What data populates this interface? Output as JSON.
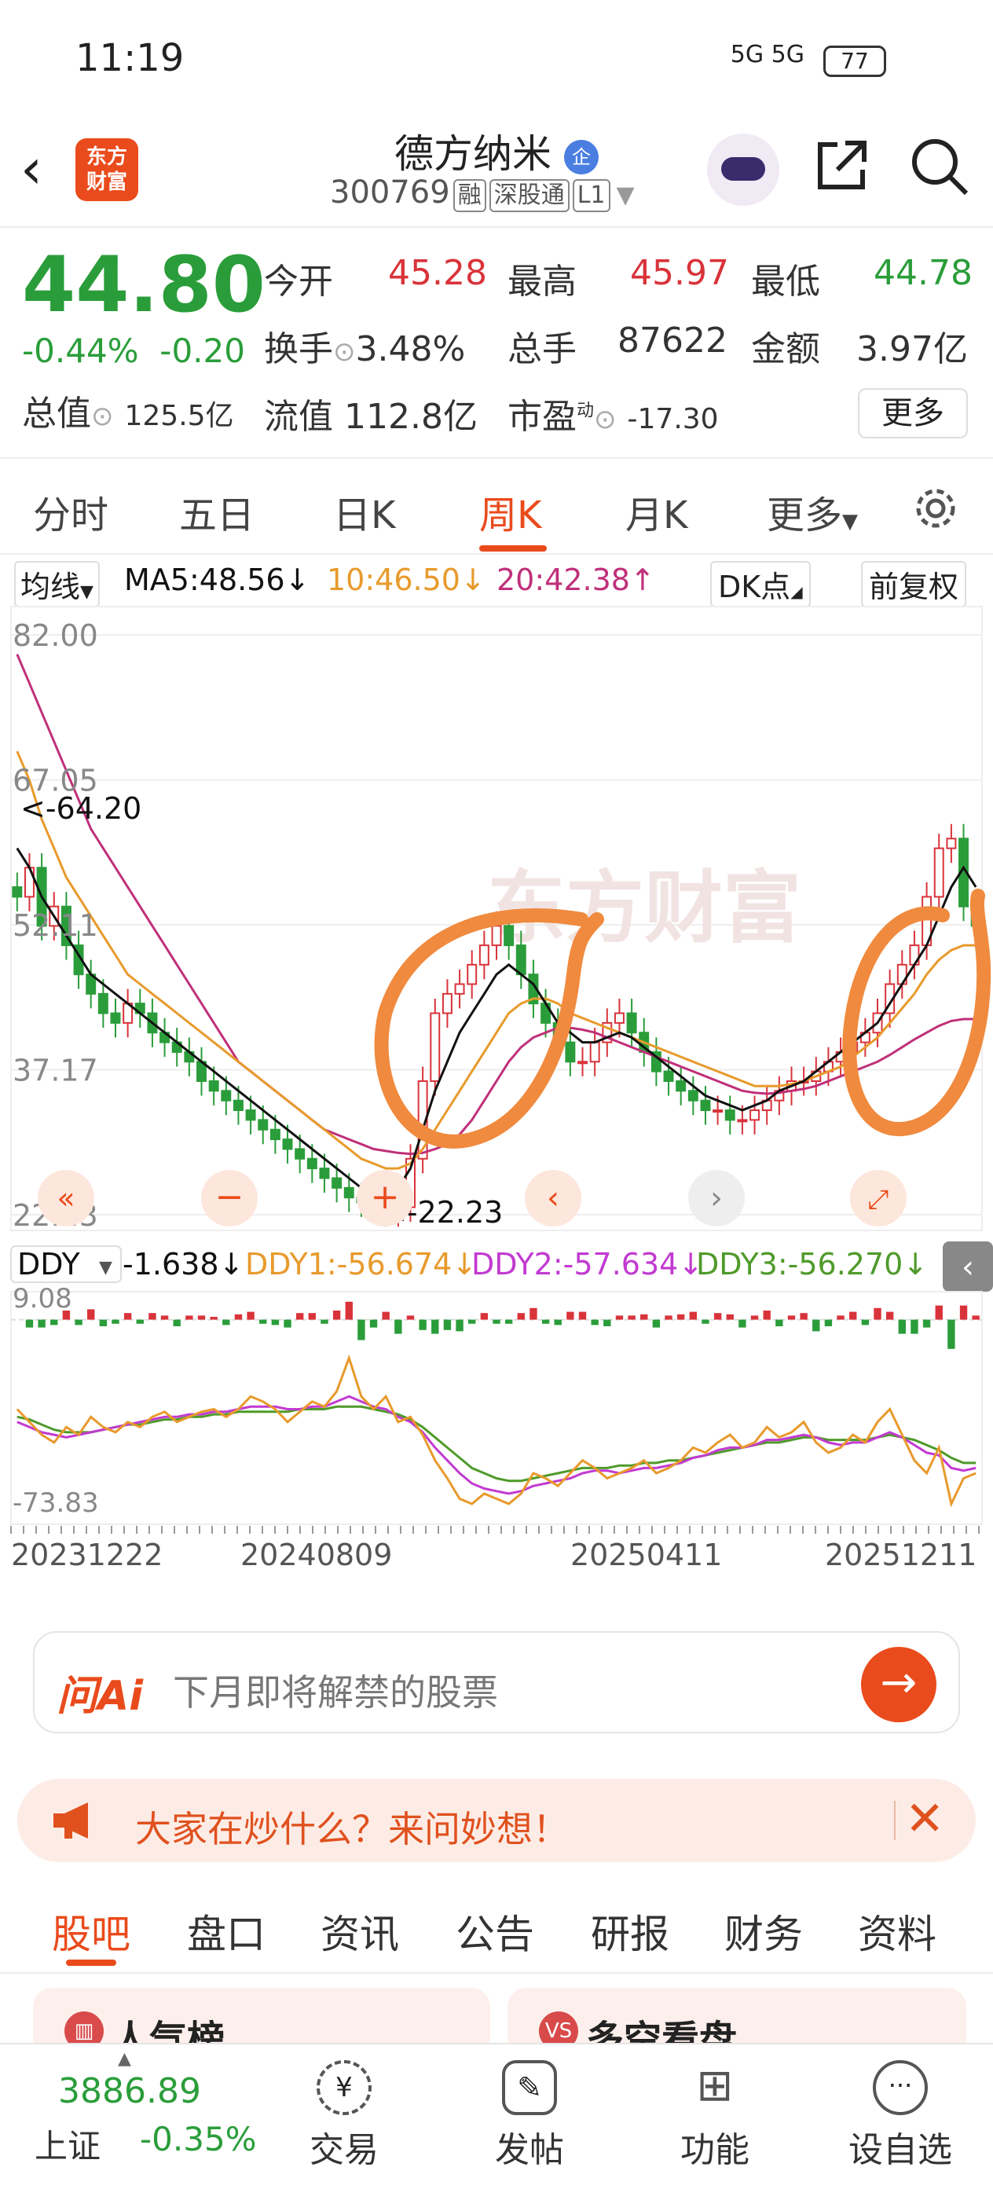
{
  "status": {
    "time": "11:19",
    "network": "5G 5G",
    "battery": "77"
  },
  "header": {
    "logo_top": "东方",
    "logo_bottom": "财富",
    "title": "德方纳米",
    "qi_badge": "企",
    "code": "300769",
    "tags": [
      "融",
      "深股通",
      "L1"
    ]
  },
  "quote": {
    "price": "44.80",
    "change_pct": "-0.44%",
    "change_abs": "-0.20",
    "open_label": "今开",
    "open": "45.28",
    "high_label": "最高",
    "high": "45.97",
    "low_label": "最低",
    "low": "44.78",
    "turnover_label": "换手",
    "turnover": "3.48%",
    "volume_label": "总手",
    "volume": "87622",
    "amount_label": "金额",
    "amount": "3.97亿",
    "mktcap_label": "总值",
    "mktcap": "125.5亿",
    "float_label": "流值",
    "float": "112.8亿",
    "pe_label": "市盈",
    "pe_sup": "动",
    "pe": "-17.30",
    "more": "更多"
  },
  "tabs": [
    "分时",
    "五日",
    "日K",
    "周K",
    "月K",
    "更多"
  ],
  "active_tab": "周K",
  "chart_bar": {
    "ma_label": "均线",
    "ma5": "MA5:48.56↓",
    "ma10": "10:46.50↓",
    "ma20": "20:42.38↑",
    "dk": "DK点",
    "adjust": "前复权"
  },
  "indicator_bar": {
    "name": "DDY",
    "v": "-1.638↓",
    "ddy1": "DDY1:-56.674↓",
    "ddy2": "DDY2:-57.634↓",
    "ddy3": "DDY3:-56.270↓"
  },
  "watermark": "东方财富",
  "ai": {
    "logo": "问Ai",
    "placeholder": "下月即将解禁的股票",
    "go": "→"
  },
  "banner": {
    "text": "大家在炒什么？来问妙想！",
    "close": "✕"
  },
  "subtabs": [
    "股吧",
    "盘口",
    "资讯",
    "公告",
    "研报",
    "财务",
    "资料"
  ],
  "cards": [
    "人气榜",
    "多空看盘"
  ],
  "bottom": {
    "index_value": "3886.89",
    "index_name": "上证",
    "index_change": "-0.35%",
    "items": [
      "交易",
      "发帖",
      "功能",
      "设自选"
    ]
  },
  "colors": {
    "up": "#d9333a",
    "down": "#2a9d3a",
    "accent": "#ea4b1c",
    "ma5": "#111111",
    "ma10": "#e89a2c",
    "ma20": "#c0307a",
    "ddy1": "#e89a2c",
    "ddy2": "#c23ad1",
    "ddy3": "#4f9a2a"
  },
  "chart_data": {
    "type": "candlestick",
    "price_axis_ticks": [
      "82.00",
      "67.05",
      "52.11",
      "37.17",
      "22.23"
    ],
    "price_range": [
      22.23,
      82.0
    ],
    "annotations": {
      "max_label": "<-64.20",
      "max_value": 64.2,
      "min_label": "<-22.23",
      "min_value": 22.23
    },
    "x_tick_labels": [
      "20231222",
      "20240809",
      "20250411",
      "20251211"
    ],
    "indicator_ticks": [
      "9.08",
      "-73.83"
    ],
    "indicator_range": [
      -73.83,
      9.08
    ],
    "close": [
      55,
      58,
      52,
      54,
      50,
      47,
      45,
      43,
      42,
      44,
      43,
      41,
      40,
      39,
      38,
      36,
      35,
      34,
      33,
      32,
      31,
      30,
      29,
      28,
      27,
      26,
      25,
      24,
      23.5,
      23,
      22.5,
      23,
      28,
      36,
      43,
      45,
      46,
      48,
      50,
      52,
      50,
      47,
      44,
      42,
      40,
      38,
      38,
      40,
      42,
      43,
      41,
      39,
      37,
      36,
      35,
      34,
      33,
      33,
      32,
      32,
      33,
      34,
      35,
      36,
      36,
      37,
      38,
      39,
      40,
      41,
      43,
      46,
      48,
      50,
      55,
      60,
      61,
      54,
      52
    ],
    "ma5": [
      60,
      58,
      55,
      53,
      51,
      49,
      47,
      46,
      45,
      44,
      43,
      42,
      41,
      40,
      39,
      38,
      37,
      36,
      35,
      34,
      33,
      32,
      31,
      30,
      29,
      28,
      27,
      26,
      25,
      24.5,
      24,
      25,
      27,
      31,
      35,
      38,
      41,
      43,
      45,
      47,
      48,
      47,
      46,
      44,
      42,
      41,
      40,
      40,
      40.5,
      41,
      40.5,
      39.5,
      38.5,
      37.5,
      36.5,
      35.5,
      34.5,
      34,
      33.5,
      33,
      33.5,
      34,
      35,
      35.5,
      36,
      37,
      38,
      39,
      40,
      41,
      42,
      44,
      46,
      48,
      50,
      53,
      56,
      58,
      56
    ],
    "ma10": [
      70,
      67,
      63,
      60,
      57,
      55,
      53,
      51,
      49,
      47,
      46,
      45,
      44,
      43,
      42,
      41,
      40,
      39,
      38,
      37,
      36,
      35,
      34,
      33,
      32,
      31,
      30,
      29,
      28,
      27.5,
      27,
      27,
      27.5,
      29,
      31,
      33,
      35,
      37,
      39,
      41,
      43,
      44,
      44.5,
      44.5,
      44,
      43,
      42.5,
      42,
      41.5,
      41,
      40.5,
      40,
      39.5,
      39,
      38.5,
      38,
      37.5,
      37,
      36.5,
      36,
      35.5,
      35.5,
      35.5,
      35.7,
      36,
      36.5,
      37,
      37.5,
      38.5,
      39.5,
      40.5,
      42,
      43.5,
      45,
      47,
      48.5,
      49.5,
      50,
      50
    ],
    "ma20": [
      80,
      77,
      74,
      71,
      68,
      65,
      62,
      60,
      58,
      56,
      54,
      52,
      50,
      48,
      46,
      44,
      42,
      40,
      38,
      37,
      36,
      35,
      34,
      33,
      32,
      31,
      30.5,
      30,
      29.5,
      29,
      28.8,
      28.6,
      28.5,
      28.6,
      29,
      29.5,
      30.5,
      32,
      34,
      36,
      38,
      39.5,
      40.5,
      41,
      41.5,
      41.5,
      41.3,
      41,
      40.5,
      40,
      39.5,
      39,
      38.5,
      38,
      37.5,
      37,
      36.5,
      36,
      35.5,
      35,
      34.8,
      34.7,
      34.8,
      35,
      35.2,
      35.5,
      36,
      36.5,
      37,
      37.5,
      38,
      38.7,
      39.5,
      40.3,
      41,
      41.7,
      42.2,
      42.4,
      42.4
    ],
    "ddy1": [
      -35,
      -40,
      -45,
      -48,
      -42,
      -45,
      -38,
      -42,
      -44,
      -40,
      -42,
      -38,
      -36,
      -40,
      -38,
      -36,
      -35,
      -38,
      -35,
      -30,
      -32,
      -35,
      -40,
      -36,
      -32,
      -34,
      -28,
      -15,
      -30,
      -35,
      -30,
      -40,
      -38,
      -45,
      -55,
      -62,
      -70,
      -72,
      -68,
      -70,
      -72,
      -68,
      -60,
      -62,
      -65,
      -60,
      -55,
      -58,
      -62,
      -60,
      -58,
      -55,
      -60,
      -58,
      -55,
      -50,
      -52,
      -48,
      -45,
      -50,
      -48,
      -42,
      -46,
      -44,
      -40,
      -48,
      -52,
      -50,
      -45,
      -48,
      -40,
      -35,
      -45,
      -55,
      -60,
      -50,
      -72,
      -62,
      -60
    ],
    "ddy2": [
      -40,
      -42,
      -44,
      -45,
      -46,
      -45,
      -44,
      -43,
      -42,
      -41,
      -40,
      -39,
      -38,
      -38,
      -37,
      -37,
      -36,
      -36,
      -35,
      -34,
      -34,
      -34,
      -35,
      -35,
      -34,
      -34,
      -32,
      -30,
      -32,
      -34,
      -35,
      -38,
      -40,
      -44,
      -50,
      -55,
      -60,
      -64,
      -66,
      -67,
      -68,
      -67,
      -65,
      -64,
      -63,
      -62,
      -60,
      -59,
      -59,
      -60,
      -59,
      -58,
      -58,
      -57,
      -56,
      -54,
      -53,
      -51,
      -50,
      -50,
      -49,
      -47,
      -47,
      -46,
      -45,
      -46,
      -48,
      -49,
      -48,
      -48,
      -46,
      -44,
      -46,
      -49,
      -52,
      -53,
      -58,
      -59,
      -58
    ],
    "ddy3": [
      -38,
      -39,
      -41,
      -43,
      -44,
      -44,
      -44,
      -43,
      -42,
      -41,
      -41,
      -40,
      -39,
      -39,
      -38,
      -38,
      -37,
      -37,
      -36,
      -36,
      -36,
      -36,
      -36,
      -35,
      -35,
      -35,
      -34,
      -34,
      -34,
      -35,
      -36,
      -37,
      -39,
      -42,
      -46,
      -50,
      -54,
      -58,
      -60,
      -62,
      -63,
      -63,
      -62,
      -61,
      -60,
      -59,
      -58,
      -58,
      -58,
      -57,
      -57,
      -56,
      -56,
      -55,
      -55,
      -54,
      -53,
      -52,
      -51,
      -50,
      -49,
      -48,
      -48,
      -47,
      -46,
      -46,
      -47,
      -47,
      -47,
      -47,
      -46,
      -45,
      -46,
      -47,
      -49,
      -51,
      -54,
      -56,
      -56
    ]
  }
}
